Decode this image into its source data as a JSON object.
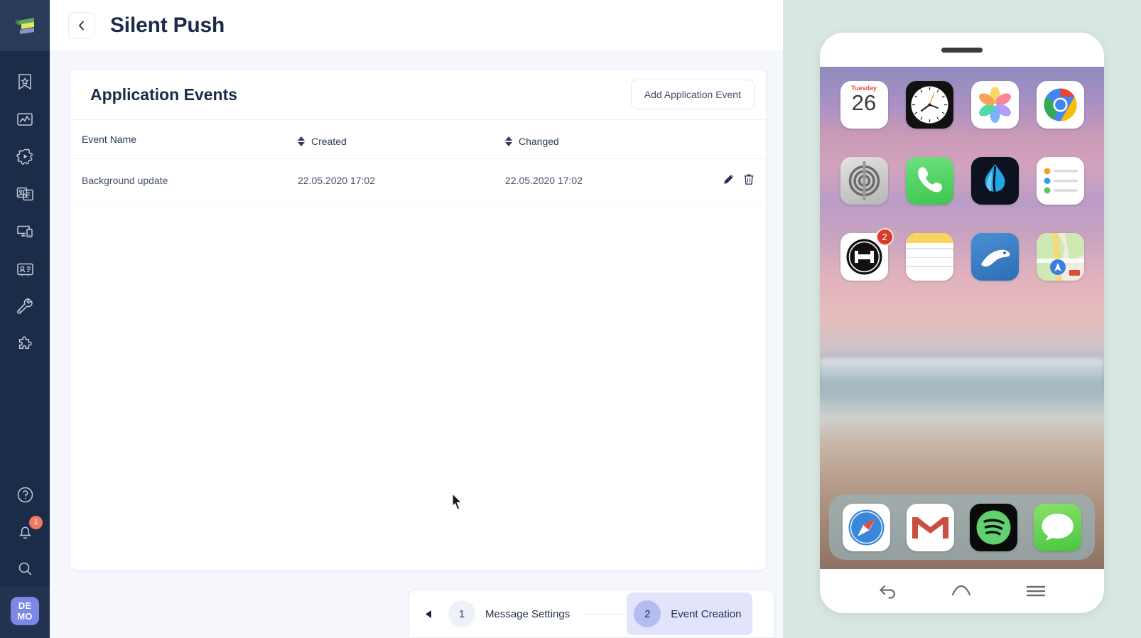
{
  "sidebar": {
    "logo": "logo-icon",
    "items": [
      {
        "name": "campaigns",
        "icon": "bookmark-star-icon"
      },
      {
        "name": "analytics",
        "icon": "chart-icon"
      },
      {
        "name": "automation",
        "icon": "gear-play-icon"
      },
      {
        "name": "content",
        "icon": "media-card-icon"
      },
      {
        "name": "devices",
        "icon": "desktop-mobile-icon"
      },
      {
        "name": "audience",
        "icon": "contact-card-icon"
      },
      {
        "name": "tools",
        "icon": "wrench-icon"
      },
      {
        "name": "integrations",
        "icon": "puzzle-icon"
      }
    ],
    "bottom_items": [
      {
        "name": "help",
        "icon": "question-circle-icon"
      },
      {
        "name": "notifications",
        "icon": "bell-icon",
        "badge": "1"
      },
      {
        "name": "search",
        "icon": "search-icon"
      }
    ],
    "account_badge": {
      "line1": "DE",
      "line2": "MO",
      "color": "#7b88e8"
    }
  },
  "header": {
    "back_icon": "chevron-left-icon",
    "title": "Silent Push"
  },
  "card": {
    "title": "Application Events",
    "add_button": "Add Application Event",
    "columns": [
      {
        "label": "Event Name",
        "sortable": false
      },
      {
        "label": "Created",
        "sortable": true
      },
      {
        "label": "Changed",
        "sortable": true
      },
      {
        "label": "",
        "sortable": false
      }
    ],
    "rows": [
      {
        "event_name": "Background update",
        "created": "22.05.2020 17:02",
        "changed": "22.05.2020 17:02",
        "actions": [
          "edit-icon",
          "delete-icon"
        ]
      }
    ]
  },
  "stepper": {
    "prev_icon": "triangle-left-icon",
    "steps": [
      {
        "number": "1",
        "label": "Message Settings",
        "active": false
      },
      {
        "number": "2",
        "label": "Event Creation",
        "active": true
      }
    ]
  },
  "preview": {
    "background_color": "#d9e7e2",
    "phone": {
      "home_apps": [
        {
          "name": "calendar",
          "label_top": "Tuesday",
          "label_day": "26"
        },
        {
          "name": "clock"
        },
        {
          "name": "photos"
        },
        {
          "name": "chrome"
        },
        {
          "name": "settings"
        },
        {
          "name": "phone"
        },
        {
          "name": "water-app"
        },
        {
          "name": "reminders"
        },
        {
          "name": "push-app",
          "badge": "2"
        },
        {
          "name": "notes"
        },
        {
          "name": "messenger-blue"
        },
        {
          "name": "maps"
        }
      ],
      "dock_apps": [
        {
          "name": "safari"
        },
        {
          "name": "gmail"
        },
        {
          "name": "spotify"
        },
        {
          "name": "messages"
        }
      ],
      "nav_buttons": [
        {
          "name": "back",
          "icon": "arrow-back-icon"
        },
        {
          "name": "home",
          "icon": "home-icon"
        },
        {
          "name": "recents",
          "icon": "menu-icon"
        }
      ]
    }
  }
}
